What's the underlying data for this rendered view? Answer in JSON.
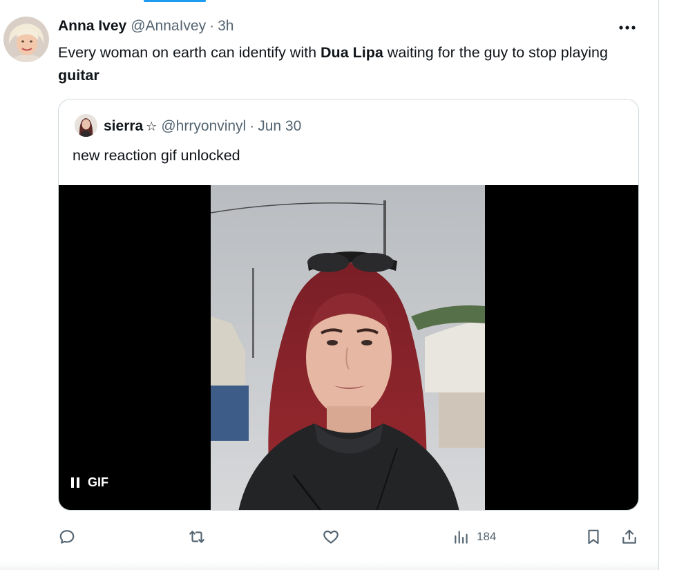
{
  "tweet": {
    "author": {
      "name": "Anna Ivey",
      "handle": "@AnnaIvey",
      "separator": "·",
      "time": "3h"
    },
    "text": {
      "part1": "Every woman on earth can identify with ",
      "bold1": "Dua Lipa",
      "part2": " waiting for the guy to stop playing ",
      "bold2": "guitar"
    },
    "more_icon": "more-horizontal-icon"
  },
  "quote": {
    "author": {
      "name": "sierra",
      "star": "☆",
      "handle": "@hrryonvinyl",
      "separator": "·",
      "time": "Jun 30"
    },
    "text": "new reaction gif unlocked",
    "media": {
      "badge_label": "GIF",
      "badge_icon": "pause-icon"
    }
  },
  "actions": {
    "reply_icon": "reply-icon",
    "retweet_icon": "retweet-icon",
    "like_icon": "like-icon",
    "views_icon": "views-icon",
    "views_count": "184",
    "bookmark_icon": "bookmark-icon",
    "share_icon": "share-icon"
  },
  "colors": {
    "accent": "#1d9bf0",
    "text": "#0f1419",
    "secondary": "#536471",
    "border": "#cfd9de"
  }
}
